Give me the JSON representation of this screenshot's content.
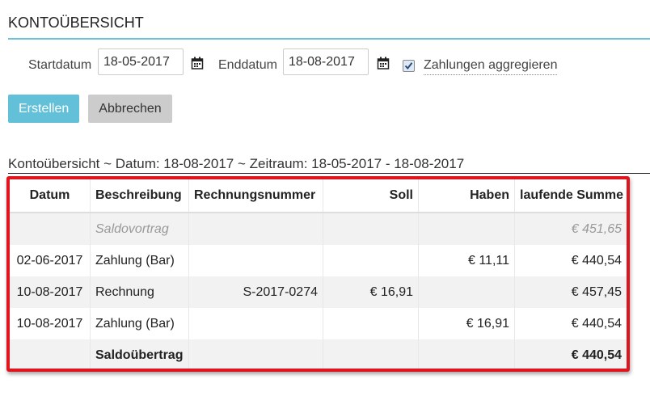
{
  "header": {
    "title": "KONTOÜBERSICHT"
  },
  "filters": {
    "start_label": "Startdatum",
    "start_value": "18-05-2017",
    "end_label": "Enddatum",
    "end_value": "18-08-2017",
    "aggregate_label": "Zahlungen aggregieren",
    "aggregate_checked": true,
    "calendar_icon": "calendar-icon"
  },
  "actions": {
    "create_label": "Erstellen",
    "cancel_label": "Abbrechen"
  },
  "report": {
    "heading": "Kontoübersicht ~ Datum: 18-08-2017 ~ Zeitraum: 18-05-2017 - 18-08-2017",
    "columns": [
      "Datum",
      "Beschreibung",
      "Rechnungsnummer",
      "Soll",
      "Haben",
      "laufende Summe"
    ],
    "rows": [
      {
        "date": "",
        "description": "Saldovortrag",
        "invoice": "",
        "debit": "",
        "credit": "",
        "balance": "€ 451,65"
      },
      {
        "date": "02-06-2017",
        "description": "Zahlung (Bar)",
        "invoice": "",
        "debit": "",
        "credit": "€ 11,11",
        "balance": "€ 440,54"
      },
      {
        "date": "10-08-2017",
        "description": "Rechnung",
        "invoice": "S-2017-0274",
        "debit": "€ 16,91",
        "credit": "",
        "balance": "€ 457,45"
      },
      {
        "date": "10-08-2017",
        "description": "Zahlung (Bar)",
        "invoice": "",
        "debit": "",
        "credit": "€ 16,91",
        "balance": "€ 440,54"
      },
      {
        "date": "",
        "description": "Saldoübertrag",
        "invoice": "",
        "debit": "",
        "credit": "",
        "balance": "€ 440,54"
      }
    ]
  },
  "colors": {
    "accent": "#62c0d8",
    "highlight_border": "#e0141c",
    "muted_text": "#999999"
  }
}
